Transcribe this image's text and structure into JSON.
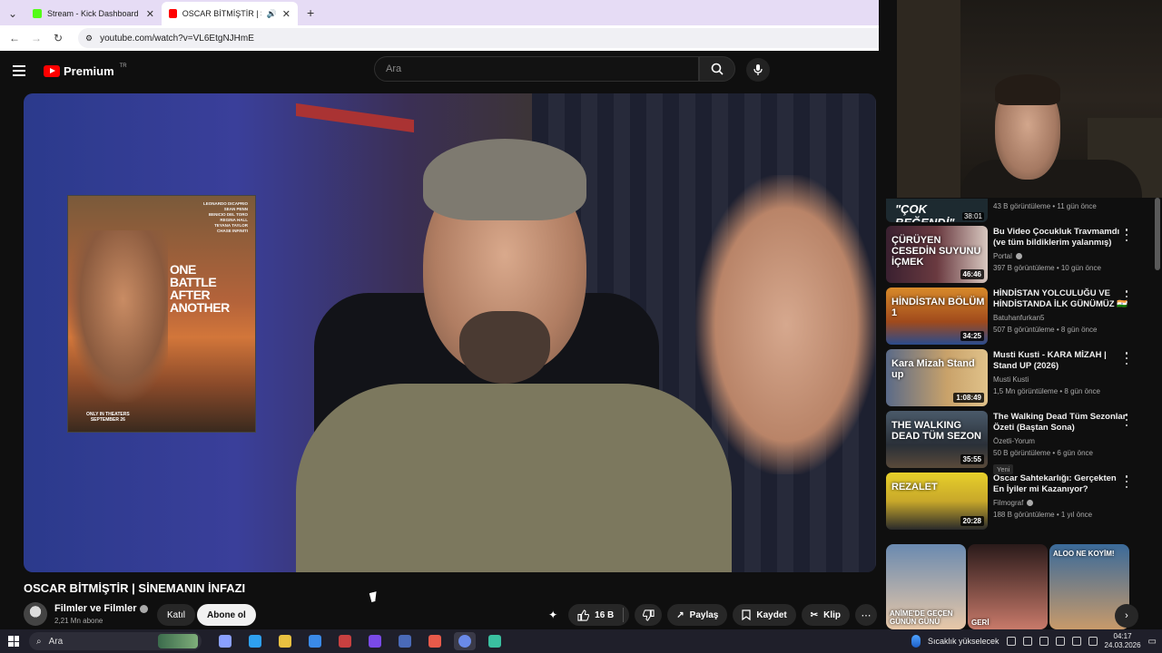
{
  "browser": {
    "tabs": [
      {
        "label": "Stream - Kick Dashboard",
        "favicon_color": "#53fc18"
      },
      {
        "label": "OSCAR BİTMİŞTİR | SİNEMA",
        "favicon_color": "#ff0000"
      }
    ],
    "url": "youtube.com/watch?v=VL6EtgNJHmE"
  },
  "yt_header": {
    "logo": "Premium",
    "logo_sup": "TR",
    "search_placeholder": "Ara"
  },
  "video": {
    "poster_names": "LEONARDO DICAPRIO\nSEAN PENN\nBENICIO DEL TORO\nREGINA HALL\nTEYANA TAYLOR\nCHASE INFINITI",
    "poster_title": "ONE\nBATTLE\nAFTER\nANOTHER",
    "poster_date": "ONLY IN THEATERS\nSEPTEMBER 26",
    "title": "OSCAR BİTMİŞTİR | SİNEMANIN İNFAZI"
  },
  "channel": {
    "name": "Filmler ve Filmler",
    "subscribers": "2,21 Mn abone",
    "join_label": "Katıl",
    "subscribe_label": "Abone ol"
  },
  "actions": {
    "likes": "16 B",
    "share": "Paylaş",
    "save": "Kaydet",
    "clip": "Klip"
  },
  "partial": {
    "thumb_text": "\"ÇOK BEĞENDİ\"",
    "duration": "38:01",
    "meta": "43 B görüntüleme • 11 gün önce"
  },
  "recommendations": [
    {
      "title": "Bu Video Çocukluk Travmamdı (ve tüm bildiklerim yalanmış)",
      "channel": "Portal",
      "verified": true,
      "views": "397 B görüntüleme • 10 gün önce",
      "duration": "46:46",
      "thumb_text": "ÇÜRÜYEN CESEDİN SUYUNU İÇMEK",
      "thumb_bg": "linear-gradient(90deg,#3a2030,#6a3a40 50%,#d8c8c0)",
      "badge": ""
    },
    {
      "title": "HİNDİSTAN YOLCULUĞU VE HİNDİSTANDA İLK GÜNÜMÜZ 🇮🇳",
      "channel": "Batuhanfurkan5",
      "verified": false,
      "views": "507 B görüntüleme • 8 gün önce",
      "duration": "34:25",
      "thumb_text": "HİNDİSTAN BÖLÜM 1",
      "thumb_bg": "linear-gradient(180deg,#d88a2a,#a04a1c 60%,#2b4b8c)",
      "badge": ""
    },
    {
      "title": "Musti Kusti - KARA MİZAH  | Stand UP (2026)",
      "channel": "Musti Kusti",
      "verified": false,
      "views": "1,5 Mn görüntüleme • 8 gün önce",
      "duration": "1:08:49",
      "thumb_text": "Kara Mizah Stand up",
      "thumb_bg": "linear-gradient(90deg,#5a6a88,#c9a26a 60%,#e0c28a)",
      "badge": ""
    },
    {
      "title": "The Walking Dead Tüm Sezonlar Özeti (Baştan Sona)",
      "channel": "Özetli-Yorum",
      "verified": false,
      "views": "50 B görüntüleme • 6 gün önce",
      "duration": "35:55",
      "thumb_text": "THE WALKING DEAD TÜM SEZON",
      "thumb_bg": "linear-gradient(180deg,#4a5a6a,#2a3038 60%,#5a4a3a)",
      "badge": "Yeni"
    },
    {
      "title": "Oscar Sahtekarlığı: Gerçekten En İyiler mi Kazanıyor?",
      "channel": "Filmograf",
      "verified": true,
      "views": "188 B görüntüleme • 1 yıl önce",
      "duration": "20:28",
      "thumb_text": "REZALET",
      "thumb_bg": "linear-gradient(180deg,#e8d02a,#c8a82a 50%,#2a2a2a)",
      "badge": ""
    }
  ],
  "shorts": [
    {
      "text": "ANİME'DE GEÇEN GÜNÜN GÜNÜ",
      "bg": "linear-gradient(180deg,#6a8ab0,#e8c8a8)"
    },
    {
      "text": "GERİ",
      "bg": "linear-gradient(180deg,#2a1a1a,#c87a6a)"
    },
    {
      "text": "ALOO NE KOYİM!",
      "bg": "linear-gradient(180deg,#3a6a9a,#c89a6a)"
    }
  ],
  "taskbar": {
    "search_label": "Ara",
    "weather": "Sıcaklık yükselecek",
    "time": "04:17",
    "date": "24.03.2026",
    "app_colors": [
      "#8aa0ff",
      "#2ea0f0",
      "#e8c040",
      "#3a8ae8",
      "#c84040",
      "#7a4ae8",
      "#4a6ab8",
      "#e85a4a",
      "#6a8ae8",
      "#3ac0a0"
    ]
  }
}
